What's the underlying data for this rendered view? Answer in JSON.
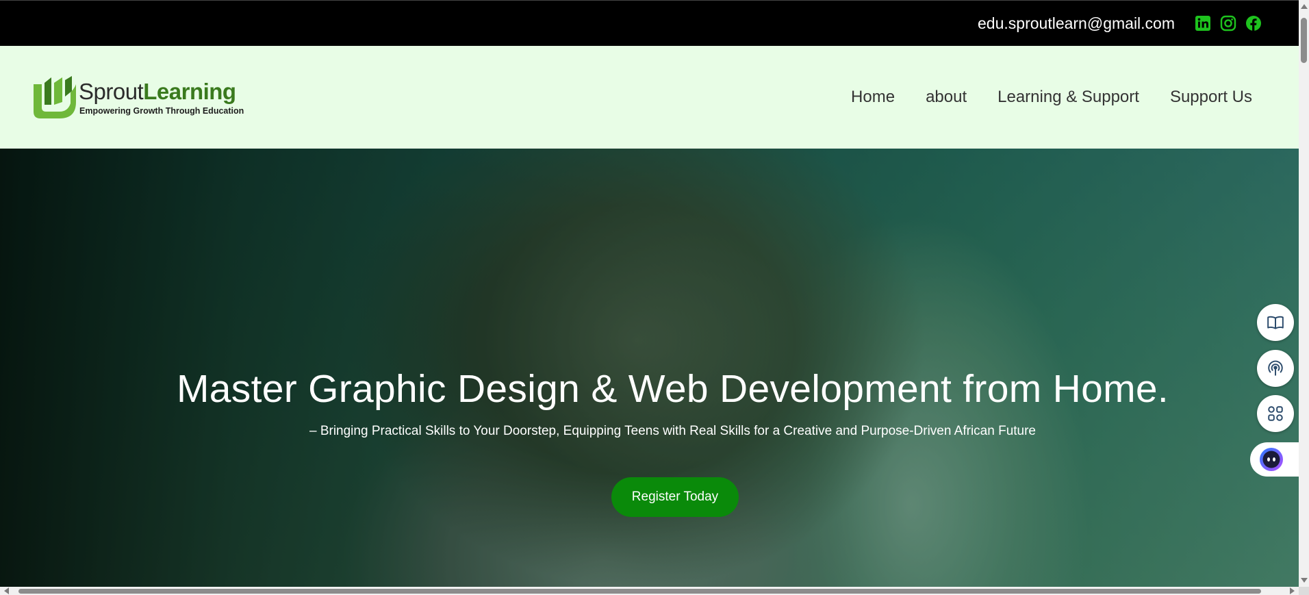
{
  "topbar": {
    "email": "edu.sproutlearn@gmail.com",
    "social": [
      {
        "icon": "linkedin-icon",
        "color": "#1ec31e"
      },
      {
        "icon": "instagram-icon",
        "color": "#1ec31e"
      },
      {
        "icon": "facebook-icon",
        "color": "#1ec31e"
      }
    ]
  },
  "header": {
    "logo": {
      "name_part1": "Sprout",
      "name_part2": "Learning",
      "tagline": "Empowering Growth Through Education",
      "brand_color": "#3a7a1e",
      "icon": "sprout-logo-icon"
    },
    "nav": [
      {
        "label": "Home"
      },
      {
        "label": "about"
      },
      {
        "label": "Learning & Support"
      },
      {
        "label": "Support Us"
      }
    ]
  },
  "hero": {
    "title": "Master Graphic Design & Web Development from Home.",
    "subtitle": "– Bringing Practical Skills to Your Doorstep, Equipping Teens with Real Skills for a Creative and Purpose-Driven African Future",
    "cta_label": "Register Today",
    "cta_color": "#0a8a0a"
  },
  "floating_tools": [
    {
      "icon": "book-open-icon"
    },
    {
      "icon": "broadcast-icon"
    },
    {
      "icon": "apps-grid-icon"
    },
    {
      "icon": "assistant-bot-icon"
    }
  ]
}
